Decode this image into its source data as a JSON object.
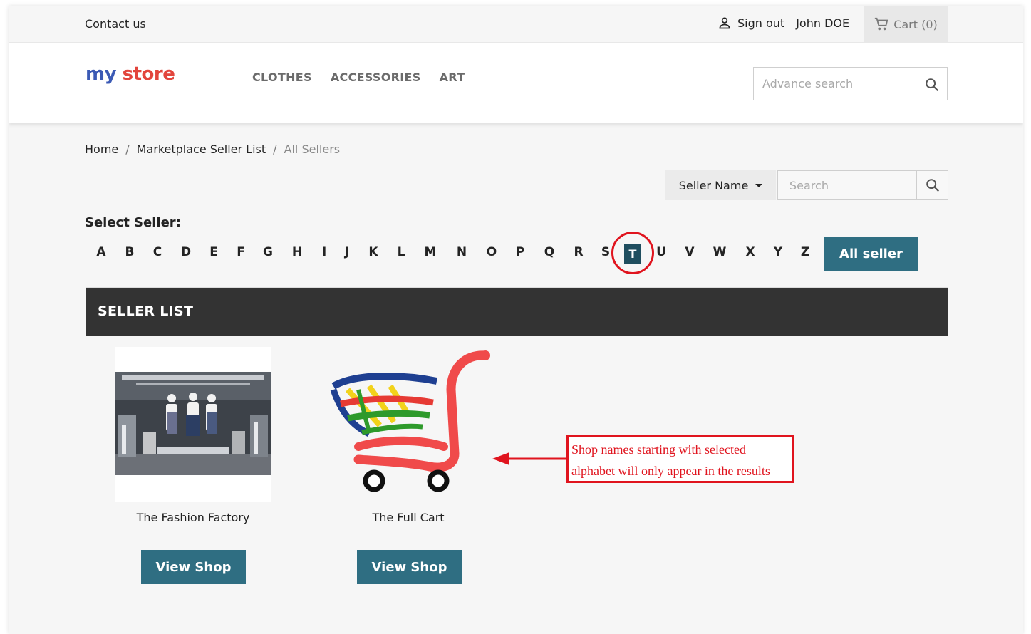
{
  "topnav": {
    "contact": "Contact us",
    "sign_out": "Sign out",
    "user_name": "John DOE",
    "cart": "Cart (0)"
  },
  "header": {
    "logo_part1": "my",
    "logo_part2": "store",
    "menu": [
      "CLOTHES",
      "ACCESSORIES",
      "ART"
    ],
    "search_placeholder": "Advance search"
  },
  "breadcrumb": {
    "items": [
      "Home",
      "Marketplace Seller List",
      "All Sellers"
    ],
    "separator": "/"
  },
  "seller_search": {
    "filter_label": "Seller Name",
    "placeholder": "Search"
  },
  "alphabet": {
    "label": "Select Seller:",
    "letters": [
      "A",
      "B",
      "C",
      "D",
      "E",
      "F",
      "G",
      "H",
      "I",
      "J",
      "K",
      "L",
      "M",
      "N",
      "O",
      "P",
      "Q",
      "R",
      "S",
      "T",
      "U",
      "V",
      "W",
      "X",
      "Y",
      "Z"
    ],
    "selected": "T",
    "all_label": "All seller"
  },
  "seller_list": {
    "title": "SELLER LIST",
    "shops": [
      {
        "name": "The Fashion Factory",
        "button": "View Shop"
      },
      {
        "name": "The Full Cart",
        "button": "View Shop"
      }
    ]
  },
  "annotation": {
    "line1": "Shop names starting with selected",
    "line2": "alphabet will only appear in the results"
  },
  "colors": {
    "accent": "#2f6e82",
    "selected_letter": "#1f4e5f",
    "annotation": "#e0141e",
    "list_header": "#333333"
  }
}
